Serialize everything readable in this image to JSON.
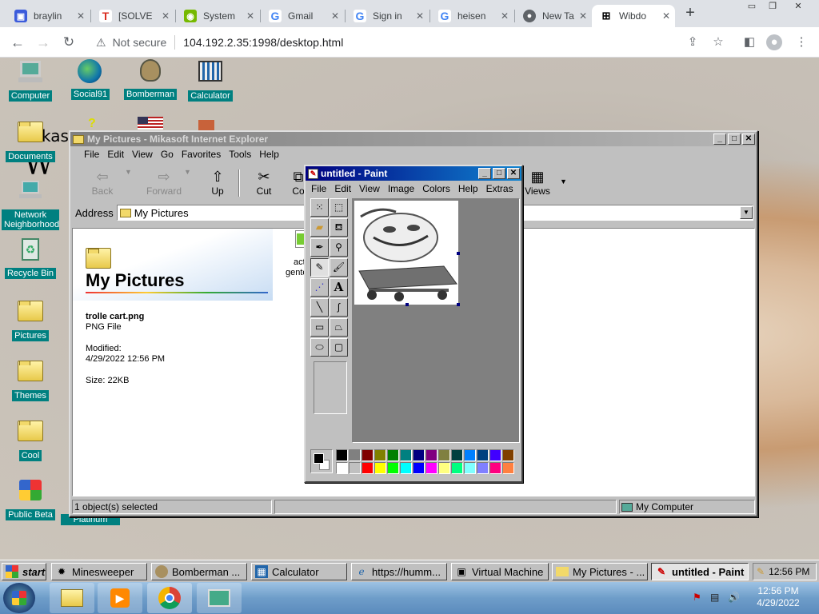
{
  "browser": {
    "tabs": [
      {
        "title": "braylin",
        "icon": "window-icon",
        "color": "#3b5bdb"
      },
      {
        "title": "[SOLVE",
        "icon": "t-icon",
        "color": "#d92d20"
      },
      {
        "title": "System",
        "icon": "nvidia-icon",
        "color": "#76b900"
      },
      {
        "title": "Gmail",
        "icon": "google-icon",
        "color": "#4285f4"
      },
      {
        "title": "Sign in",
        "icon": "google-icon",
        "color": "#4285f4"
      },
      {
        "title": "heisen",
        "icon": "google-icon",
        "color": "#4285f4"
      },
      {
        "title": "New Ta",
        "icon": "chrome-icon",
        "color": "#5f6368"
      },
      {
        "title": "Wibdo",
        "icon": "windows-logo-icon",
        "color": "#000000"
      }
    ],
    "address": {
      "security": "Not secure",
      "url": "104.192.2.35:1998/desktop.html"
    }
  },
  "desktop_icons": [
    {
      "label": "Computer",
      "icon": "computer-icon"
    },
    {
      "label": "Social91",
      "icon": "globe-icon"
    },
    {
      "label": "Bomberman",
      "icon": "bomberman-icon"
    },
    {
      "label": "Calculator",
      "icon": "calculator-icon"
    },
    {
      "label": "Documents",
      "icon": "folder-icon"
    },
    {
      "label": "Network Neighborhood",
      "icon": "network-icon"
    },
    {
      "label": "Recycle Bin",
      "icon": "recycle-bin-icon"
    },
    {
      "label": "Pictures",
      "icon": "folder-icon"
    },
    {
      "label": "Themes",
      "icon": "folder-icon"
    },
    {
      "label": "Cool",
      "icon": "folder-icon"
    },
    {
      "label": "Public Beta",
      "icon": "windows-flag-icon"
    },
    {
      "label": "Platinum",
      "icon": "folder-icon"
    }
  ],
  "explorer": {
    "title": "My Pictures - Mikasoft Internet Explorer",
    "menu": [
      "File",
      "Edit",
      "View",
      "Go",
      "Favorites",
      "Tools",
      "Help"
    ],
    "toolbar": [
      "Back",
      "Forward",
      "Up",
      "Cut",
      "Co",
      "Views"
    ],
    "address_label": "Address",
    "address_value": "My Pictures",
    "folder_title": "My Pictures",
    "file_name": "trolle cart.png",
    "file_type": "PNG File",
    "modified_label": "Modified:",
    "modified_value": "4/29/2022 12:56 PM",
    "size": "Size: 22KB",
    "item_label_1": "act",
    "item_label_2": "gento",
    "status_left": "1 object(s) selected",
    "status_right": "My Computer"
  },
  "paint": {
    "title": "untitled - Paint",
    "menu": [
      "File",
      "Edit",
      "View",
      "Image",
      "Colors",
      "Help",
      "Extras"
    ],
    "tools": [
      "free-select-icon",
      "rect-select-icon",
      "eraser-icon",
      "fill-icon",
      "color-picker-icon",
      "magnifier-icon",
      "pencil-icon",
      "brush-icon",
      "airbrush-icon",
      "text-icon",
      "line-icon",
      "curve-icon",
      "rectangle-icon",
      "polygon-icon",
      "ellipse-icon",
      "rounded-rect-icon"
    ],
    "text_tool_glyph": "A",
    "palette_top": [
      "#000000",
      "#808080",
      "#800000",
      "#808000",
      "#008000",
      "#008080",
      "#000080",
      "#800080",
      "#808040",
      "#004040",
      "#0080ff",
      "#004080",
      "#4000ff",
      "#804000"
    ],
    "palette_bottom": [
      "#ffffff",
      "#c0c0c0",
      "#ff0000",
      "#ffff00",
      "#00ff00",
      "#00ffff",
      "#0000ff",
      "#ff00ff",
      "#ffff80",
      "#00ff80",
      "#80ffff",
      "#8080ff",
      "#ff0080",
      "#ff8040"
    ],
    "primary_color": "#000000",
    "secondary_color": "#ffffff"
  },
  "taskbar98": {
    "start": "start",
    "tasks": [
      {
        "label": "Minesweeper",
        "icon": "mine-icon"
      },
      {
        "label": "Bomberman ...",
        "icon": "bomberman-icon"
      },
      {
        "label": "Calculator",
        "icon": "calculator-icon"
      },
      {
        "label": "https://humm...",
        "icon": "ie-icon"
      },
      {
        "label": "Virtual Machine",
        "icon": "vm-icon"
      },
      {
        "label": "My Pictures - ...",
        "icon": "folder-icon"
      },
      {
        "label": "untitled - Paint",
        "icon": "paint-icon",
        "active": true
      }
    ],
    "clock": "12:56 PM"
  },
  "win7": {
    "time": "12:56 PM",
    "date": "4/29/2022"
  }
}
